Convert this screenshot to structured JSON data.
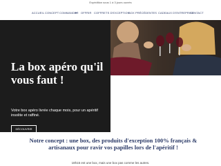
{
  "announcement": "Expédition sous 1 à 3 jours ouvrés",
  "nav": {
    "items": [
      "ACCUEIL",
      "CONCEPT",
      "COMMANDER",
      "OFFRIR",
      "COFFRETS D'EXCEPTION",
      "BOX PRÉCÉDENTES",
      "CADEAUX D'ENTREPRISE",
      "CONTACT"
    ],
    "caret": "▾"
  },
  "hero": {
    "title": "La box apéro qu'il vous faut !",
    "subtitle": "Votre box apéro livrée chaque mois, pour un apéritif insolite et raffiné.",
    "button_label": "DÉCOUVRIR"
  },
  "concept": {
    "heading": "Notre concept : une box, des produits d'exception 100% français & artisanaux pour ravir vos papilles lors de l'apéritif !",
    "tagline": "18h15 est une box, mais une box pas comme les autres."
  },
  "colors": {
    "accent": "#2b3a67",
    "dark": "#1c1c1c"
  }
}
